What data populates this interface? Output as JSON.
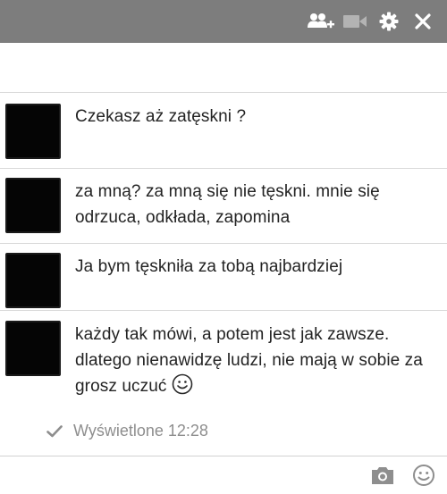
{
  "titlebar": {
    "icons": [
      "add-friends-icon",
      "video-camera-icon",
      "gear-icon",
      "close-icon"
    ],
    "colors": {
      "bar": "#7d7d7d",
      "icon": "#ffffff",
      "video_icon_disabled": "#b3b3b3"
    }
  },
  "messages": [
    {
      "text": "Czekasz aż zatęskni ?"
    },
    {
      "text": "za mną? za mną się nie tęskni. mnie się odrzuca, odkłada, zapomina"
    },
    {
      "text": "Ja bym tęskniła za tobą najbardziej"
    },
    {
      "text": "każdy tak mówi, a potem jest jak zawsze. dlatego nienawidzę ludzi, nie mają w sobie za grosz uczuć",
      "emoticon": "smiley-icon"
    }
  ],
  "seen": {
    "label": "Wyświetlone 12:28"
  },
  "compose": {
    "placeholder": "",
    "icons": [
      "camera-icon",
      "emoji-icon"
    ]
  }
}
